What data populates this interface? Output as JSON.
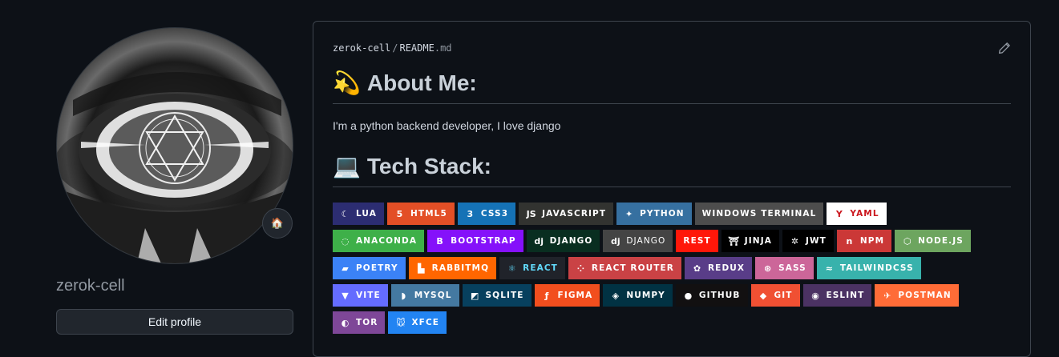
{
  "profile": {
    "username": "zerok-cell",
    "edit_button": "Edit profile",
    "status_icon": "house-icon"
  },
  "readme": {
    "owner": "zerok-cell",
    "separator": "/",
    "file_base": "README",
    "file_ext": ".md",
    "about_heading": "About Me:",
    "about_emoji": "💫",
    "about_text": "I'm a python backend developer, I love django",
    "tech_heading": "Tech Stack:",
    "tech_emoji": "💻"
  },
  "badges": [
    [
      {
        "label": "LUA",
        "bg": "#2c2d72",
        "icon": "lua-icon",
        "glyph": "☾"
      },
      {
        "label": "HTML5",
        "bg": "#e34f26",
        "icon": "html5-icon",
        "glyph": "5"
      },
      {
        "label": "CSS3",
        "bg": "#1572b6",
        "icon": "css3-icon",
        "glyph": "3"
      },
      {
        "label": "JAVASCRIPT",
        "bg": "#323330",
        "icon": "javascript-icon",
        "glyph": "JS"
      },
      {
        "label": "PYTHON",
        "bg": "#3670a0",
        "icon": "python-icon",
        "glyph": "✦"
      },
      {
        "label": "WINDOWS TERMINAL",
        "bg": "#4d4d4d",
        "icon": "",
        "glyph": ""
      },
      {
        "label": "YAML",
        "bg": "#ffffff",
        "fg": "#cb171e",
        "icon": "yaml-icon",
        "glyph": "Y"
      }
    ],
    [
      {
        "label": "ANACONDA",
        "bg": "#3eb049",
        "icon": "anaconda-icon",
        "glyph": "◌"
      },
      {
        "label": "BOOTSTRAP",
        "bg": "#8511fa",
        "icon": "bootstrap-icon",
        "glyph": "B"
      },
      {
        "label": "DJANGO",
        "bg": "#092e20",
        "icon": "django-icon",
        "glyph": "dj"
      },
      {
        "label": "DJANGO",
        "bg": "#444444",
        "icon": "django-icon",
        "glyph": "dj",
        "weight": "normal"
      },
      {
        "label": "REST",
        "bg": "#ff1709",
        "icon": "",
        "glyph": ""
      },
      {
        "label": "JINJA",
        "bg": "#000000",
        "icon": "jinja-icon",
        "glyph": "⛩"
      },
      {
        "label": "JWT",
        "bg": "#000000",
        "icon": "jwt-icon",
        "glyph": "✲"
      },
      {
        "label": "NPM",
        "bg": "#cb3837",
        "icon": "npm-icon",
        "glyph": "n"
      },
      {
        "label": "NODE.JS",
        "bg": "#6da55f",
        "icon": "nodejs-icon",
        "glyph": "⬡"
      }
    ],
    [
      {
        "label": "POETRY",
        "bg": "#3b82f6",
        "icon": "poetry-icon",
        "glyph": "▰"
      },
      {
        "label": "RABBITMQ",
        "bg": "#ff6600",
        "icon": "rabbitmq-icon",
        "glyph": "▙"
      },
      {
        "label": "REACT",
        "bg": "#20232a",
        "fg": "#61dafb",
        "icon": "react-icon",
        "glyph": "⚛"
      },
      {
        "label": "REACT ROUTER",
        "bg": "#ca4245",
        "icon": "react-router-icon",
        "glyph": "⁘"
      },
      {
        "label": "REDUX",
        "bg": "#593d88",
        "icon": "redux-icon",
        "glyph": "✿"
      },
      {
        "label": "SASS",
        "bg": "#cc6699",
        "icon": "sass-icon",
        "glyph": "⊛"
      },
      {
        "label": "TAILWINDCSS",
        "bg": "#38b2ac",
        "icon": "tailwind-icon",
        "glyph": "≈"
      }
    ],
    [
      {
        "label": "VITE",
        "bg": "#646cff",
        "icon": "vite-icon",
        "glyph": "▼"
      },
      {
        "label": "MYSQL",
        "bg": "#4479a1",
        "icon": "mysql-icon",
        "glyph": "◗"
      },
      {
        "label": "SQLITE",
        "bg": "#07405e",
        "icon": "sqlite-icon",
        "glyph": "◩"
      },
      {
        "label": "FIGMA",
        "bg": "#f24e1e",
        "icon": "figma-icon",
        "glyph": "ƒ"
      },
      {
        "label": "NUMPY",
        "bg": "#013243",
        "icon": "numpy-icon",
        "glyph": "◈"
      },
      {
        "label": "GITHUB",
        "bg": "#121011",
        "icon": "github-icon",
        "glyph": "●"
      },
      {
        "label": "GIT",
        "bg": "#f05033",
        "icon": "git-icon",
        "glyph": "◆"
      },
      {
        "label": "ESLINT",
        "bg": "#4b3263",
        "icon": "eslint-icon",
        "glyph": "◉"
      },
      {
        "label": "POSTMAN",
        "bg": "#ff6c37",
        "icon": "postman-icon",
        "glyph": "✈"
      }
    ],
    [
      {
        "label": "TOR",
        "bg": "#7e4798",
        "icon": "tor-icon",
        "glyph": "◐"
      },
      {
        "label": "XFCE",
        "bg": "#2284f2",
        "icon": "xfce-icon",
        "glyph": "🐭"
      }
    ]
  ]
}
